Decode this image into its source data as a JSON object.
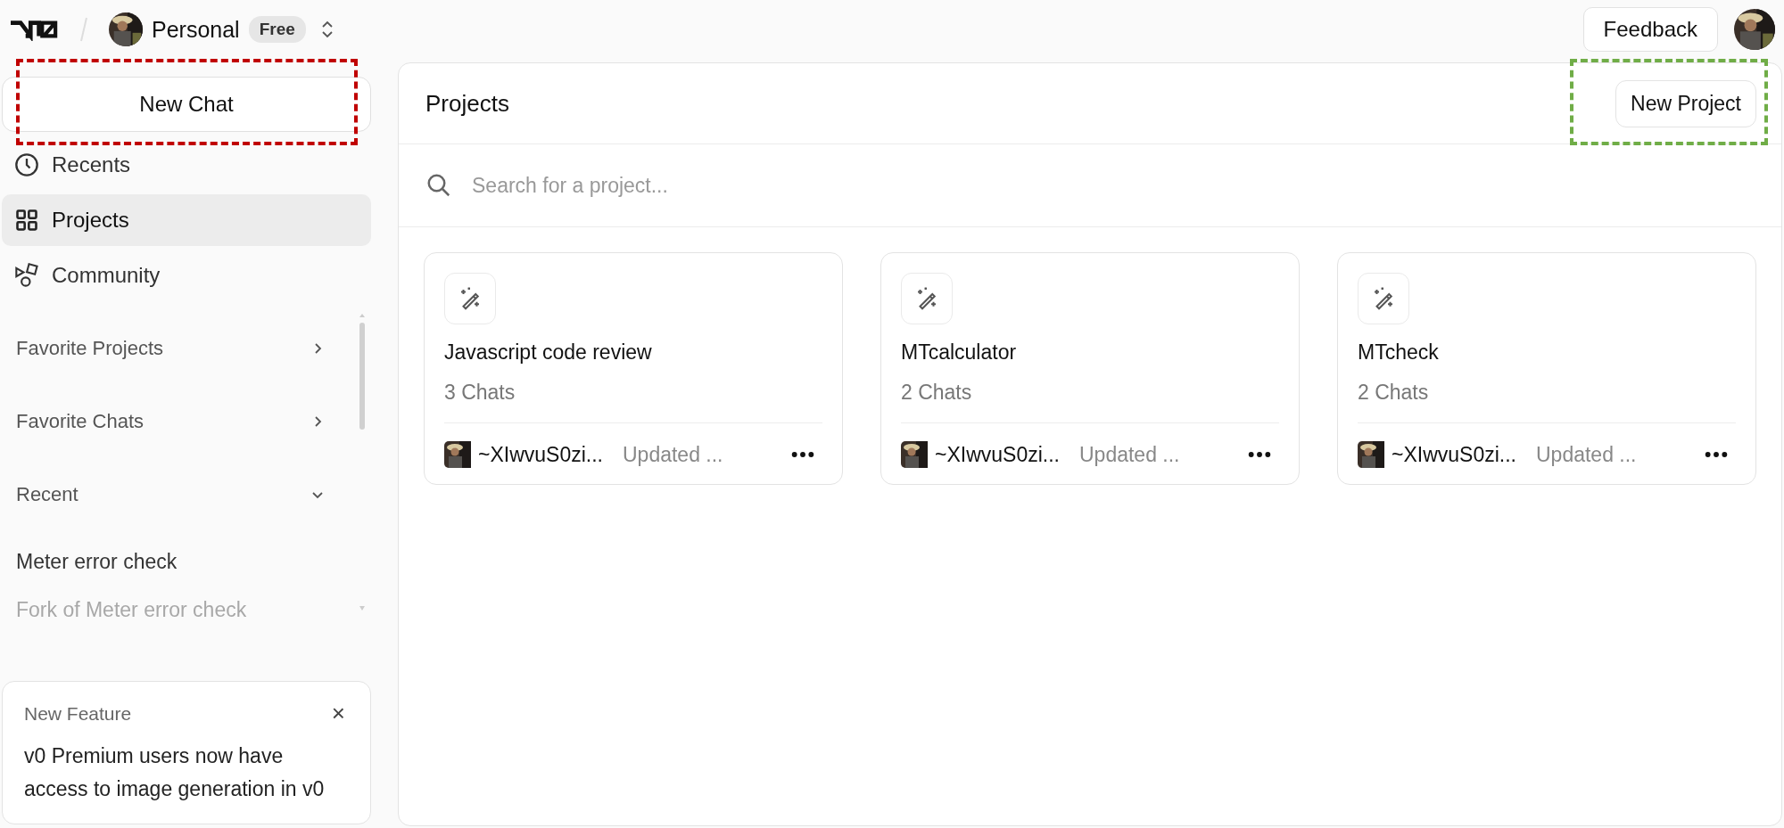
{
  "topbar": {
    "workspace": "Personal",
    "plan": "Free",
    "feedback": "Feedback"
  },
  "sidebar": {
    "new_chat": {
      "label": "New Chat",
      "color": "#c00000"
    },
    "nav": [
      {
        "kind": "clock",
        "label": "Recents",
        "selected": false
      },
      {
        "kind": "grid",
        "label": "Projects",
        "selected": true
      },
      {
        "kind": "shapes",
        "label": "Community",
        "selected": false
      }
    ],
    "sections": [
      {
        "label": "Favorite Projects",
        "expanded": false
      },
      {
        "label": "Favorite Chats",
        "expanded": false
      },
      {
        "label": "Recent",
        "expanded": true
      }
    ],
    "recent": [
      {
        "label": "Meter error check",
        "faded": false
      },
      {
        "label": "Fork of Meter error check",
        "faded": true
      }
    ],
    "notice": {
      "title": "New Feature",
      "close": "×",
      "body": "v0 Premium users now have access to image generation in v0"
    }
  },
  "main": {
    "title": "Projects",
    "new_project": {
      "label": "New Project",
      "color": "#70ad47"
    },
    "search": {
      "placeholder": "Search for a project..."
    },
    "projects": [
      {
        "name": "Javascript code review",
        "chats": "3 Chats",
        "owner": "~XIwvuS0zi...",
        "updated": "Updated ..."
      },
      {
        "name": "MTcalculator",
        "chats": "2 Chats",
        "owner": "~XIwvuS0zi...",
        "updated": "Updated ..."
      },
      {
        "name": "MTcheck",
        "chats": "2 Chats",
        "owner": "~XIwvuS0zi...",
        "updated": "Updated ..."
      }
    ]
  }
}
